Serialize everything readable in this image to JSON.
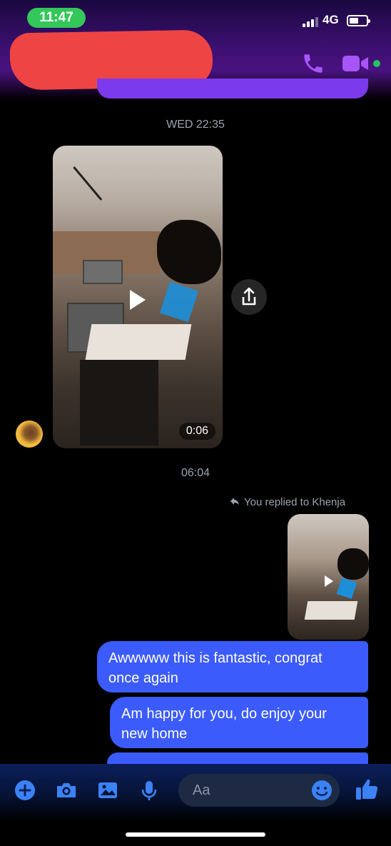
{
  "status_bar": {
    "time": "11:47",
    "network": "4G"
  },
  "header": {
    "contact_name": "",
    "accent_color": "#7c3aed",
    "icons": [
      "back-icon",
      "phone-icon",
      "video-call-icon"
    ],
    "online": true
  },
  "thread": {
    "timestamp_1": "WED 22:35",
    "video": {
      "duration": "0:06",
      "icons": [
        "play-icon",
        "share-icon"
      ]
    },
    "timestamp_2": "06:04",
    "reply_label": "You replied to Khenja",
    "messages": [
      {
        "text": "Awwwww this is fantastic, congrat once again",
        "sender": "me"
      },
      {
        "text": "Am happy for you, do enjoy your new home",
        "sender": "me"
      }
    ],
    "bubble_color": "#3b5bfd"
  },
  "composer": {
    "placeholder": "Aa",
    "icons": [
      "plus-icon",
      "camera-icon",
      "gallery-icon",
      "mic-icon",
      "emoji-icon",
      "like-icon"
    ]
  }
}
